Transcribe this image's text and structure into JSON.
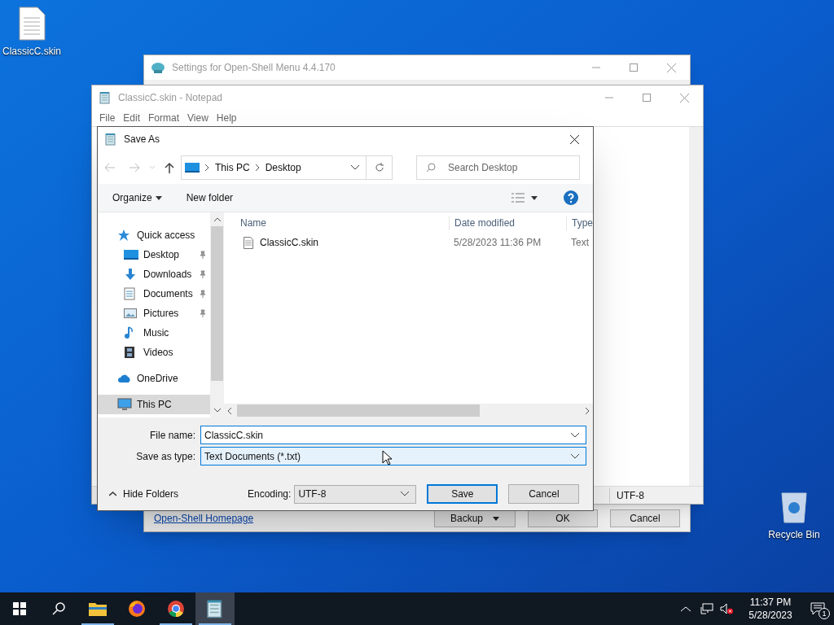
{
  "desktop_icons": [
    {
      "kind": "file",
      "label": "ClassicC.skin"
    },
    {
      "kind": "recycle",
      "label": "Recycle Bin"
    }
  ],
  "settings_window": {
    "title": "Settings for Open-Shell Menu 4.4.170",
    "link": "Open-Shell Homepage",
    "buttons": [
      {
        "label": "Backup",
        "dropdown": true
      },
      {
        "label": "OK",
        "dropdown": false
      },
      {
        "label": "Cancel",
        "dropdown": false
      }
    ]
  },
  "notepad": {
    "title": "ClassicC.skin - Notepad",
    "menu": [
      "File",
      "Edit",
      "Format",
      "View",
      "Help"
    ],
    "status_encoding": "UTF-8"
  },
  "save_dialog": {
    "title": "Save As",
    "breadcrumb": [
      "This PC",
      "Desktop"
    ],
    "search_placeholder": "Search Desktop",
    "organize": "Organize",
    "new_folder": "New folder",
    "nav": [
      {
        "kind": "quick",
        "label": "Quick access",
        "selected": false,
        "children": [
          {
            "kind": "desktop",
            "label": "Desktop",
            "pinned": true,
            "selected": false
          },
          {
            "kind": "downloads",
            "label": "Downloads",
            "pinned": true,
            "selected": false
          },
          {
            "kind": "documents",
            "label": "Documents",
            "pinned": true,
            "selected": false
          },
          {
            "kind": "pictures",
            "label": "Pictures",
            "pinned": true,
            "selected": false
          },
          {
            "kind": "music",
            "label": "Music",
            "pinned": false,
            "selected": false
          },
          {
            "kind": "videos",
            "label": "Videos",
            "pinned": false,
            "selected": false
          }
        ]
      },
      {
        "kind": "onedrive",
        "label": "OneDrive",
        "selected": false
      },
      {
        "kind": "pc",
        "label": "This PC",
        "selected": true
      }
    ],
    "columns": [
      "Name",
      "Date modified",
      "Type"
    ],
    "files": [
      {
        "name": "ClassicC.skin",
        "date": "5/28/2023 11:36 PM",
        "type": "Text"
      }
    ],
    "file_name_label": "File name:",
    "file_name": "ClassicC.skin",
    "save_type_label": "Save as type:",
    "save_type": "Text Documents (*.txt)",
    "hide_folders": "Hide Folders",
    "encoding_label": "Encoding:",
    "encoding": "UTF-8",
    "save": "Save",
    "cancel": "Cancel"
  },
  "taskbar": {
    "apps": [
      {
        "kind": "explorer",
        "running": true,
        "active": false
      },
      {
        "kind": "firefox",
        "running": false,
        "active": false
      },
      {
        "kind": "chrome",
        "running": true,
        "active": false
      },
      {
        "kind": "notepad",
        "running": true,
        "active": true
      }
    ],
    "time": "11:37 PM",
    "date": "5/28/2023",
    "notification_count": "1"
  }
}
